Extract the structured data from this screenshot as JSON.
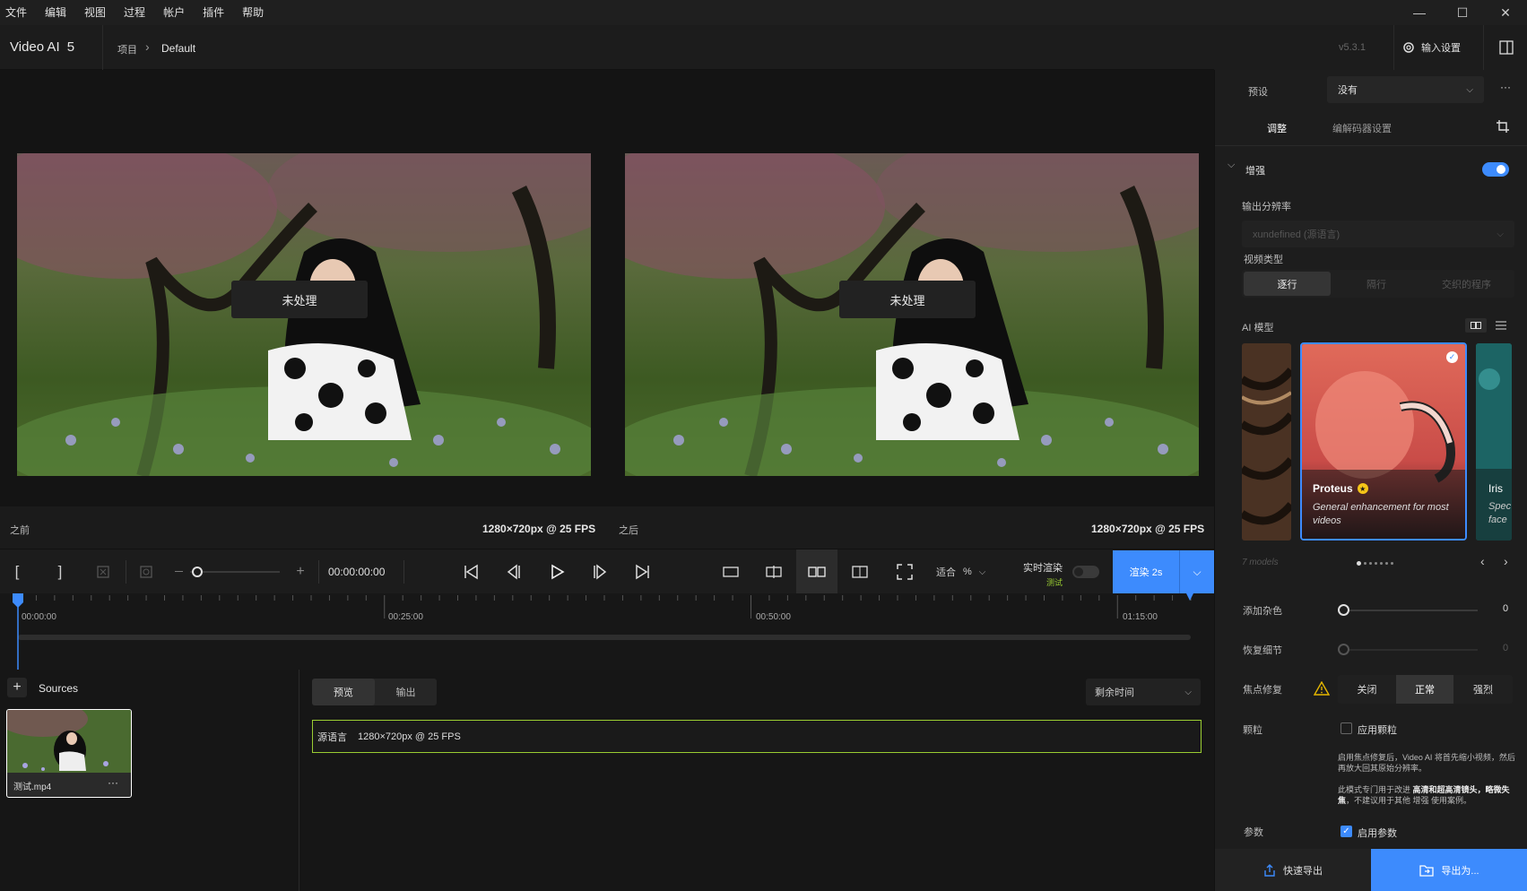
{
  "menu": {
    "items": [
      "文件",
      "编辑",
      "视图",
      "过程",
      "帐户",
      "插件",
      "帮助"
    ]
  },
  "window_controls": {
    "minimize": "—",
    "maximize": "☐",
    "close": "✕"
  },
  "app": {
    "title": "Video AI",
    "version_major": "5",
    "breadcrumb_project": "项目",
    "breadcrumb_sep": "›",
    "breadcrumb_current": "Default",
    "version": "v5.3.1",
    "input_settings": "输入设置"
  },
  "viewer": {
    "left_overlay": "未处理",
    "right_overlay": "未处理"
  },
  "info": {
    "before_label": "之前",
    "before_res": "1280×720px @ 25 FPS",
    "after_label": "之后",
    "after_res": "1280×720px @ 25 FPS"
  },
  "controls": {
    "in_mark": "[",
    "out_mark": "]",
    "timecode": "00:00:00:00",
    "zoom_label": "适合",
    "zoom_unit": "%",
    "realtime_label": "实时渲染",
    "realtime_tag": "测试",
    "render_label": "渲染 2s"
  },
  "timeline": {
    "ticks": [
      "00:00:00",
      "00:25:00",
      "00:50:00",
      "01:15:00"
    ]
  },
  "sources": {
    "title": "Sources",
    "add": "+",
    "file_name": "测试.mp4",
    "file_menu": "···"
  },
  "queue": {
    "tabs": [
      "预览",
      "输出"
    ],
    "sort_label": "剩余时间",
    "item_label": "源语言",
    "item_res": "1280×720px @ 25 FPS"
  },
  "sidebar": {
    "preset_label": "预设",
    "preset_value": "没有",
    "more": "···",
    "tabs": [
      "调整",
      "编解码器设置"
    ],
    "enhance_label": "增强",
    "enhance_on": true,
    "output_res_label": "输出分辨率",
    "output_res_value": "xundefined (源语言)",
    "video_type_label": "视频类型",
    "video_types": [
      "逐行",
      "隔行",
      "交织的程序"
    ],
    "ai_model_label": "AI 模型",
    "model_name": "Proteus",
    "model_desc": "General enhancement for most videos",
    "next_model_name": "Iris",
    "next_model_desc": "Spec face",
    "models_count": "7 models",
    "noise_label": "添加杂色",
    "noise_value": "0",
    "detail_label": "恢复细节",
    "detail_value": "0",
    "focus_label": "焦点修复",
    "focus_options": [
      "关闭",
      "正常",
      "强烈"
    ],
    "grain_label": "颗粒",
    "grain_checkbox": "应用颗粒",
    "note1": "启用焦点修复后，Video AI 将首先缩小视频，然后再放大回其原始分辨率。",
    "note2_prefix": "此模式专门用于改进 ",
    "note2_bold": "高清和超高清镜头，略微失焦",
    "note2_suffix": "，不建议用于其他 增强 使用案例。",
    "params_label": "参数",
    "params_checkbox": "启用参数",
    "quick_export": "快速导出",
    "export_as": "导出为..."
  },
  "colors": {
    "accent": "#3d8bfd",
    "highlight": "#9acd32",
    "proteus_star": "#f5c518"
  }
}
